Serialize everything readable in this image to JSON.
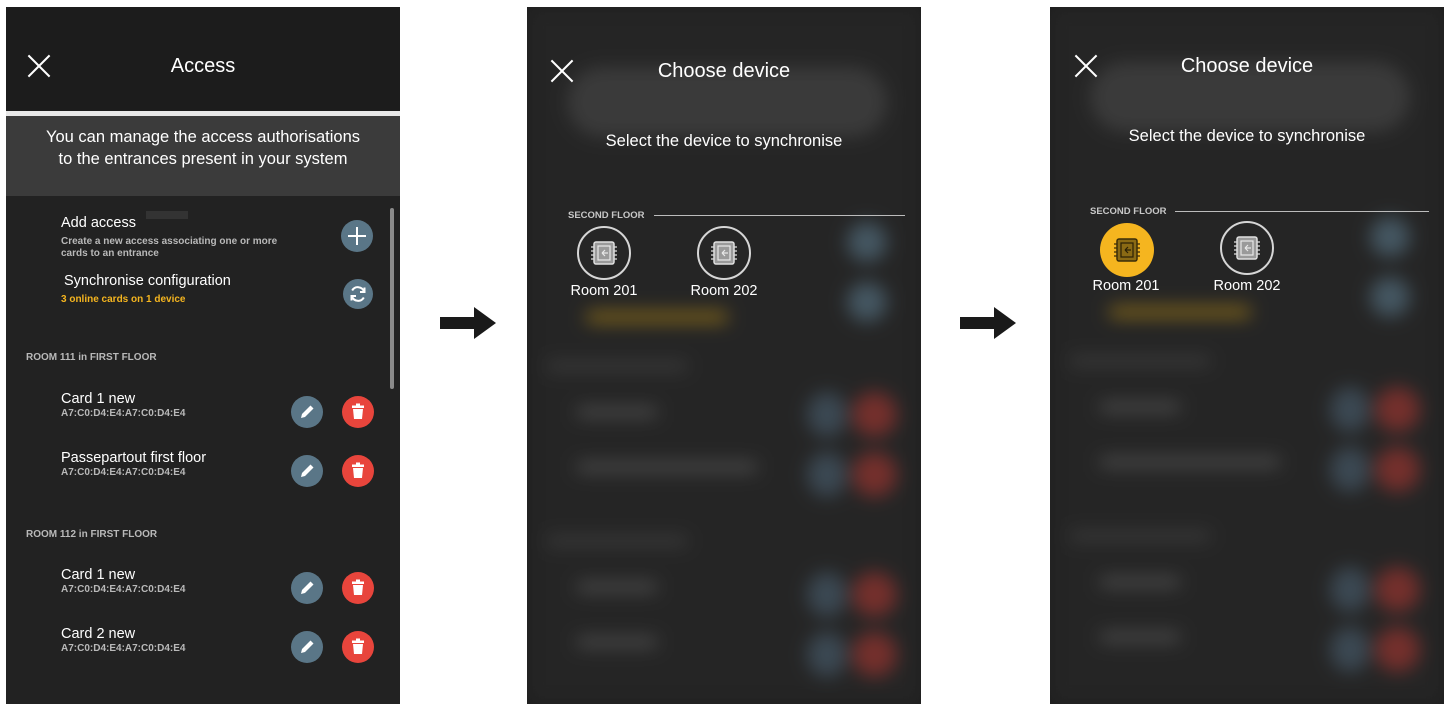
{
  "screen1": {
    "title": "Access",
    "info_line1": "You can manage the access authorisations",
    "info_line2": "to the entrances present in your system",
    "add_access": {
      "title": "Add access",
      "desc_line1": "Create a new access associating one or more",
      "desc_line2": "cards to an entrance"
    },
    "sync": {
      "title": "Synchronise configuration",
      "status": "3 online cards on 1 device"
    },
    "groups": [
      {
        "label": "ROOM 111 in FIRST FLOOR",
        "items": [
          {
            "name": "Card 1 new",
            "mac": "A7:C0:D4:E4:A7:C0:D4:E4"
          },
          {
            "name": "Passepartout first floor",
            "mac": "A7:C0:D4:E4:A7:C0:D4:E4"
          }
        ]
      },
      {
        "label": "ROOM 112 in FIRST FLOOR",
        "items": [
          {
            "name": "Card 1 new",
            "mac": "A7:C0:D4:E4:A7:C0:D4:E4"
          },
          {
            "name": "Card 2 new",
            "mac": "A7:C0:D4:E4:A7:C0:D4:E4"
          }
        ]
      }
    ],
    "colors": {
      "edit": "#5a7687",
      "delete": "#e8453c",
      "status": "#f5b51f"
    }
  },
  "screen2": {
    "title": "Choose device",
    "subtitle": "Select the device to synchronise",
    "floor": "SECOND FLOOR",
    "devices": [
      {
        "label": "Room 201",
        "selected": false
      },
      {
        "label": "Room 202",
        "selected": false
      }
    ]
  },
  "screen3": {
    "title": "Choose device",
    "subtitle": "Select the device to synchronise",
    "floor": "SECOND FLOOR",
    "devices": [
      {
        "label": "Room 201",
        "selected": true
      },
      {
        "label": "Room 202",
        "selected": false
      }
    ],
    "selected_color": "#f5b51f"
  }
}
